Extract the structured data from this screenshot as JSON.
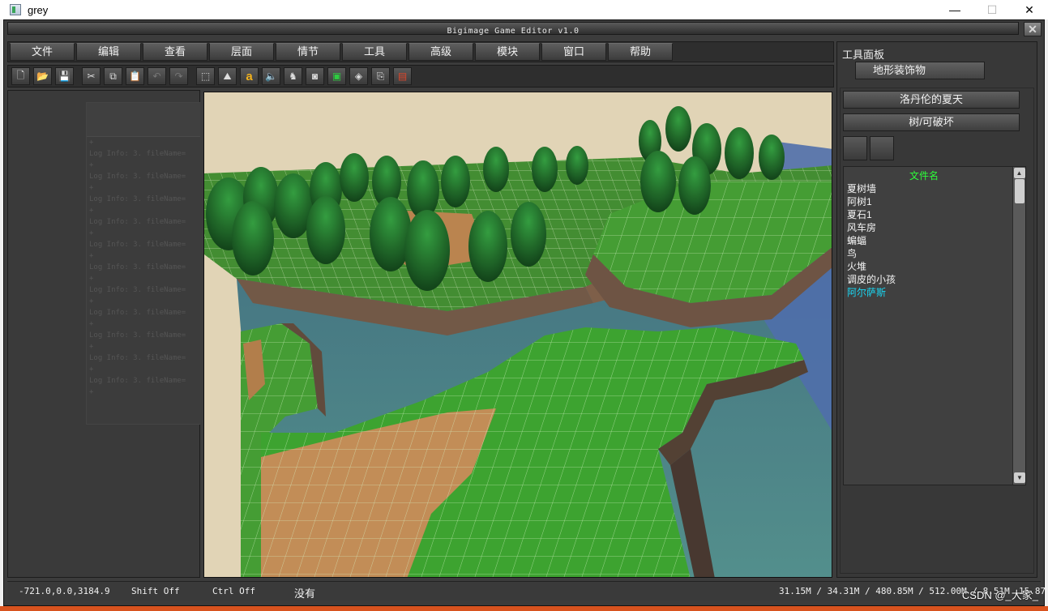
{
  "window": {
    "title": "grey",
    "minimize": "—",
    "maximize": "☐",
    "close": "✕"
  },
  "editor": {
    "title": "Bigimage Game Editor v1.0",
    "close": "✕"
  },
  "menu": [
    "文件",
    "编辑",
    "查看",
    "层面",
    "情节",
    "工具",
    "高级",
    "模块",
    "窗口",
    "帮助"
  ],
  "toolbar": [
    {
      "icon": "new-file-icon",
      "glyph": "🗋"
    },
    {
      "icon": "open-folder-icon",
      "glyph": "📂"
    },
    {
      "icon": "save-icon",
      "glyph": "💾"
    },
    {
      "icon": "cut-icon",
      "glyph": "✂"
    },
    {
      "icon": "copy-icon",
      "glyph": "⧉"
    },
    {
      "icon": "paste-icon",
      "glyph": "📋"
    },
    {
      "icon": "undo-icon",
      "glyph": "↶"
    },
    {
      "icon": "redo-icon",
      "glyph": "↷"
    },
    {
      "icon": "select-rect-icon",
      "glyph": "⬚"
    },
    {
      "icon": "terrain-icon",
      "glyph": "⛰"
    },
    {
      "icon": "text-icon",
      "glyph": "a"
    },
    {
      "icon": "sound-icon",
      "glyph": "🔈"
    },
    {
      "icon": "unit-icon",
      "glyph": "♞"
    },
    {
      "icon": "camera-icon",
      "glyph": "◙"
    },
    {
      "icon": "region-icon",
      "glyph": "▣"
    },
    {
      "icon": "object-icon",
      "glyph": "◈"
    },
    {
      "icon": "import-icon",
      "glyph": "⎘"
    },
    {
      "icon": "script-icon",
      "glyph": "▤"
    }
  ],
  "log": {
    "lines": [
      "+",
      "Log Info: 3. fileName=",
      "+",
      "Log Info: 3. fileName=",
      "+",
      "Log Info: 3. fileName=",
      "+",
      "Log Info: 3. fileName=",
      "+",
      "Log Info: 3. fileName=",
      "+",
      "Log Info: 3. fileName=",
      "+",
      "Log Info: 3. fileName=",
      "+",
      "Log Info: 3. fileName=",
      "+",
      "Log Info: 3. fileName=",
      "+",
      "Log Info: 3. fileName=",
      "+",
      "Log Info: 3. fileName=",
      "+"
    ]
  },
  "tool_panel": {
    "title": "工具面板",
    "tab": "地形装饰物",
    "buttons": [
      "洛丹伦的夏天",
      "树/可破坏"
    ],
    "file_list_header": "文件名",
    "files": [
      "夏树墙",
      "阿树1",
      "夏石1",
      "风车房",
      "蝙蝠",
      "鸟",
      "火堆",
      "调皮的小孩",
      "阿尔萨斯"
    ],
    "selected_file": "阿尔萨斯"
  },
  "status": {
    "coords": "-721.0,0.0,3184.9",
    "shift": "Shift Off",
    "ctrl": "Ctrl Off",
    "state": "没有",
    "memory": "31.15M / 34.31M / 480.85M / 512.00M / 8.51M",
    "fps": "15.87"
  },
  "watermark": "CSDN @_大家_"
}
